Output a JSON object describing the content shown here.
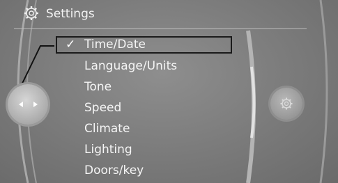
{
  "header": {
    "title": "Settings",
    "icon": "gear-icon"
  },
  "menu": {
    "items": [
      {
        "label": "Time/Date",
        "selected": true,
        "check": "✓"
      },
      {
        "label": "Language/Units",
        "selected": false
      },
      {
        "label": "Tone",
        "selected": false
      },
      {
        "label": "Speed",
        "selected": false
      },
      {
        "label": "Climate",
        "selected": false
      },
      {
        "label": "Lighting",
        "selected": false
      },
      {
        "label": "Doors/key",
        "selected": false
      }
    ]
  },
  "controller": {
    "left_icon": "arrow-left-icon",
    "right_icon": "arrow-right-icon"
  },
  "options_knob": {
    "icon": "options-icon"
  },
  "colors": {
    "background": "#7a7a7a",
    "text": "#f5f5f5",
    "highlight_border": "#1a1a1a"
  }
}
